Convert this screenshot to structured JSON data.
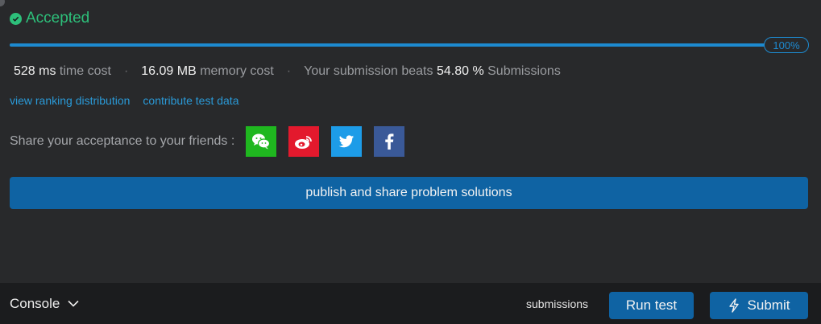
{
  "result": {
    "status": "Accepted",
    "status_color": "#2dbf7a",
    "progress_percent": 100,
    "progress_label": "100%"
  },
  "stats": {
    "time_value": "528 ms",
    "time_label": "time cost",
    "memory_value": "16.09 MB",
    "memory_label": "memory cost",
    "beats_prefix": "Your submission beats",
    "beats_value": "54.80 %",
    "beats_suffix": "Submissions",
    "separator": "·"
  },
  "links": {
    "ranking": "view ranking distribution",
    "contribute": "contribute test data"
  },
  "share": {
    "label": "Share your acceptance to your friends :",
    "icons": [
      "wechat-icon",
      "weibo-icon",
      "twitter-icon",
      "facebook-icon"
    ]
  },
  "publish": {
    "label": "publish and share problem solutions"
  },
  "footer": {
    "console_label": "Console",
    "submissions_label": "submissions",
    "run_label": "Run test",
    "submit_label": "Submit"
  },
  "colors": {
    "accent": "#0f63a3",
    "link": "#2a9ad8",
    "background": "#28292b",
    "footer": "#1b1c1e"
  }
}
